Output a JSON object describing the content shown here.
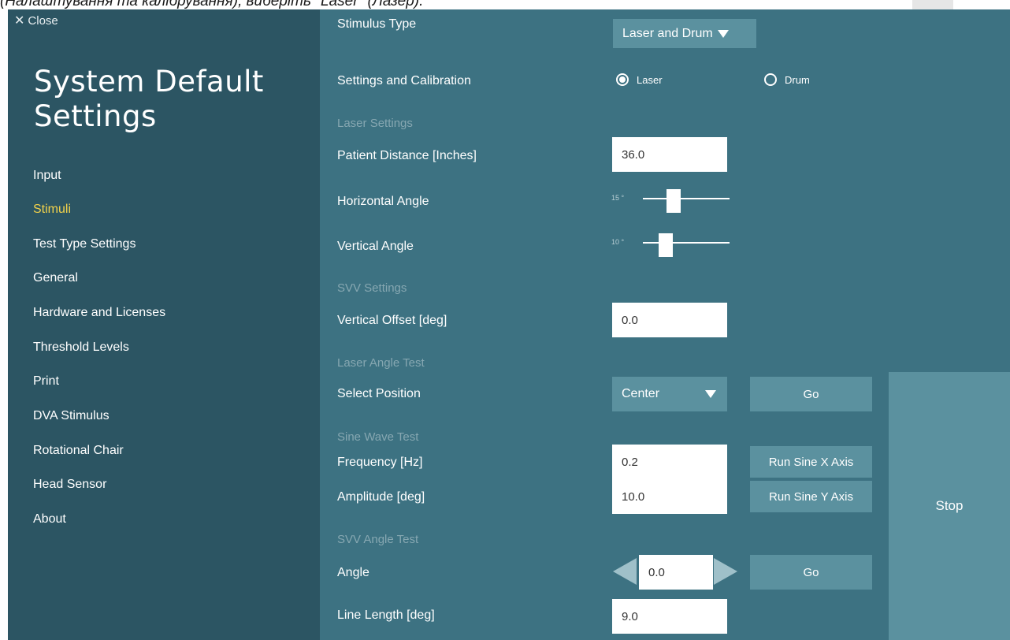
{
  "caption": "(Налаштування та калібрування), виберіть \"Laser\" (Лазер).",
  "sidebar": {
    "close_label": "Close",
    "title": "System Default Settings",
    "items": [
      {
        "label": "Input"
      },
      {
        "label": "Stimuli",
        "active": true
      },
      {
        "label": "Test Type Settings"
      },
      {
        "label": "General"
      },
      {
        "label": "Hardware and Licenses"
      },
      {
        "label": "Threshold Levels"
      },
      {
        "label": "Print"
      },
      {
        "label": "DVA Stimulus"
      },
      {
        "label": "Rotational Chair"
      },
      {
        "label": "Head Sensor"
      },
      {
        "label": "About"
      }
    ]
  },
  "main": {
    "stimulus_type": {
      "label": "Stimulus Type",
      "value": "Laser and Drum"
    },
    "settings_calibration": {
      "label": "Settings and Calibration",
      "options": [
        {
          "label": "Laser",
          "selected": true
        },
        {
          "label": "Drum",
          "selected": false
        }
      ]
    },
    "laser_settings": {
      "heading": "Laser Settings",
      "patient_distance": {
        "label": "Patient Distance  [Inches]",
        "value": "36.0"
      },
      "horizontal_angle": {
        "label": "Horizontal Angle",
        "value_text": "15 °",
        "fraction": 0.33
      },
      "vertical_angle": {
        "label": "Vertical Angle",
        "value_text": "10 °",
        "fraction": 0.22
      }
    },
    "svv_settings": {
      "heading": "SVV Settings",
      "vertical_offset": {
        "label": "Vertical Offset  [deg]",
        "value": "0.0"
      }
    },
    "laser_angle_test": {
      "heading": "Laser Angle Test",
      "select_position": {
        "label": "Select Position",
        "value": "Center"
      },
      "go_label": "Go"
    },
    "sine_wave_test": {
      "heading": "Sine Wave Test",
      "frequency": {
        "label": "Frequency [Hz]",
        "value": "0.2"
      },
      "amplitude": {
        "label": "Amplitude [deg]",
        "value": "10.0"
      },
      "run_x_label": "Run Sine X Axis",
      "run_y_label": "Run Sine Y Axis"
    },
    "svv_angle_test": {
      "heading": "SVV Angle Test",
      "angle": {
        "label": "Angle",
        "value": "0.0"
      },
      "go_label": "Go",
      "line_length": {
        "label": "Line Length [deg]",
        "value": "9.0"
      }
    },
    "stop_label": "Stop"
  },
  "colors": {
    "sidebar_bg": "#2c5563",
    "main_bg": "#3d7282",
    "button_bg": "#5b919f",
    "active_item": "#f2d24a",
    "section_heading": "#86a7b1"
  }
}
